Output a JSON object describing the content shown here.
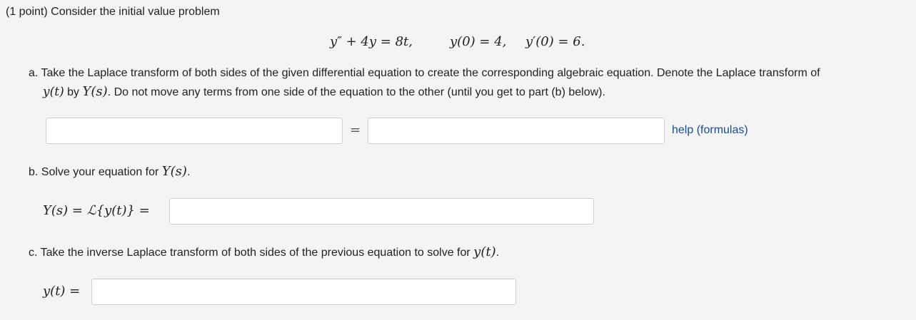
{
  "problem": {
    "intro": "(1 point) Consider the initial value problem",
    "equation": {
      "ode": "y″ + 4y = 8t,",
      "ic1": "y(0) = 4,",
      "ic2": "y′(0) = 6."
    }
  },
  "part_a": {
    "line1": "a. Take the Laplace transform of both sides of the given differential equation to create the corresponding algebraic equation. Denote the Laplace transform of",
    "line2_math1": "y(t)",
    "line2_by": " by ",
    "line2_math2": "Y(s)",
    "line2_rest": ". Do not move any terms from one side of the equation to the other (until you get to part (b) below).",
    "left_value": "",
    "right_value": "",
    "equals": "=",
    "help_label": "help (formulas)"
  },
  "part_b": {
    "text": "b. Solve your equation for ",
    "text_math": "Y(s)",
    "text_end": ".",
    "label": "Y(s) = ℒ{y(t)} =",
    "value": ""
  },
  "part_c": {
    "text": "c. Take the inverse Laplace transform of both sides of the previous equation to solve for ",
    "text_math": "y(t)",
    "text_end": ".",
    "label": "y(t) =",
    "value": ""
  }
}
